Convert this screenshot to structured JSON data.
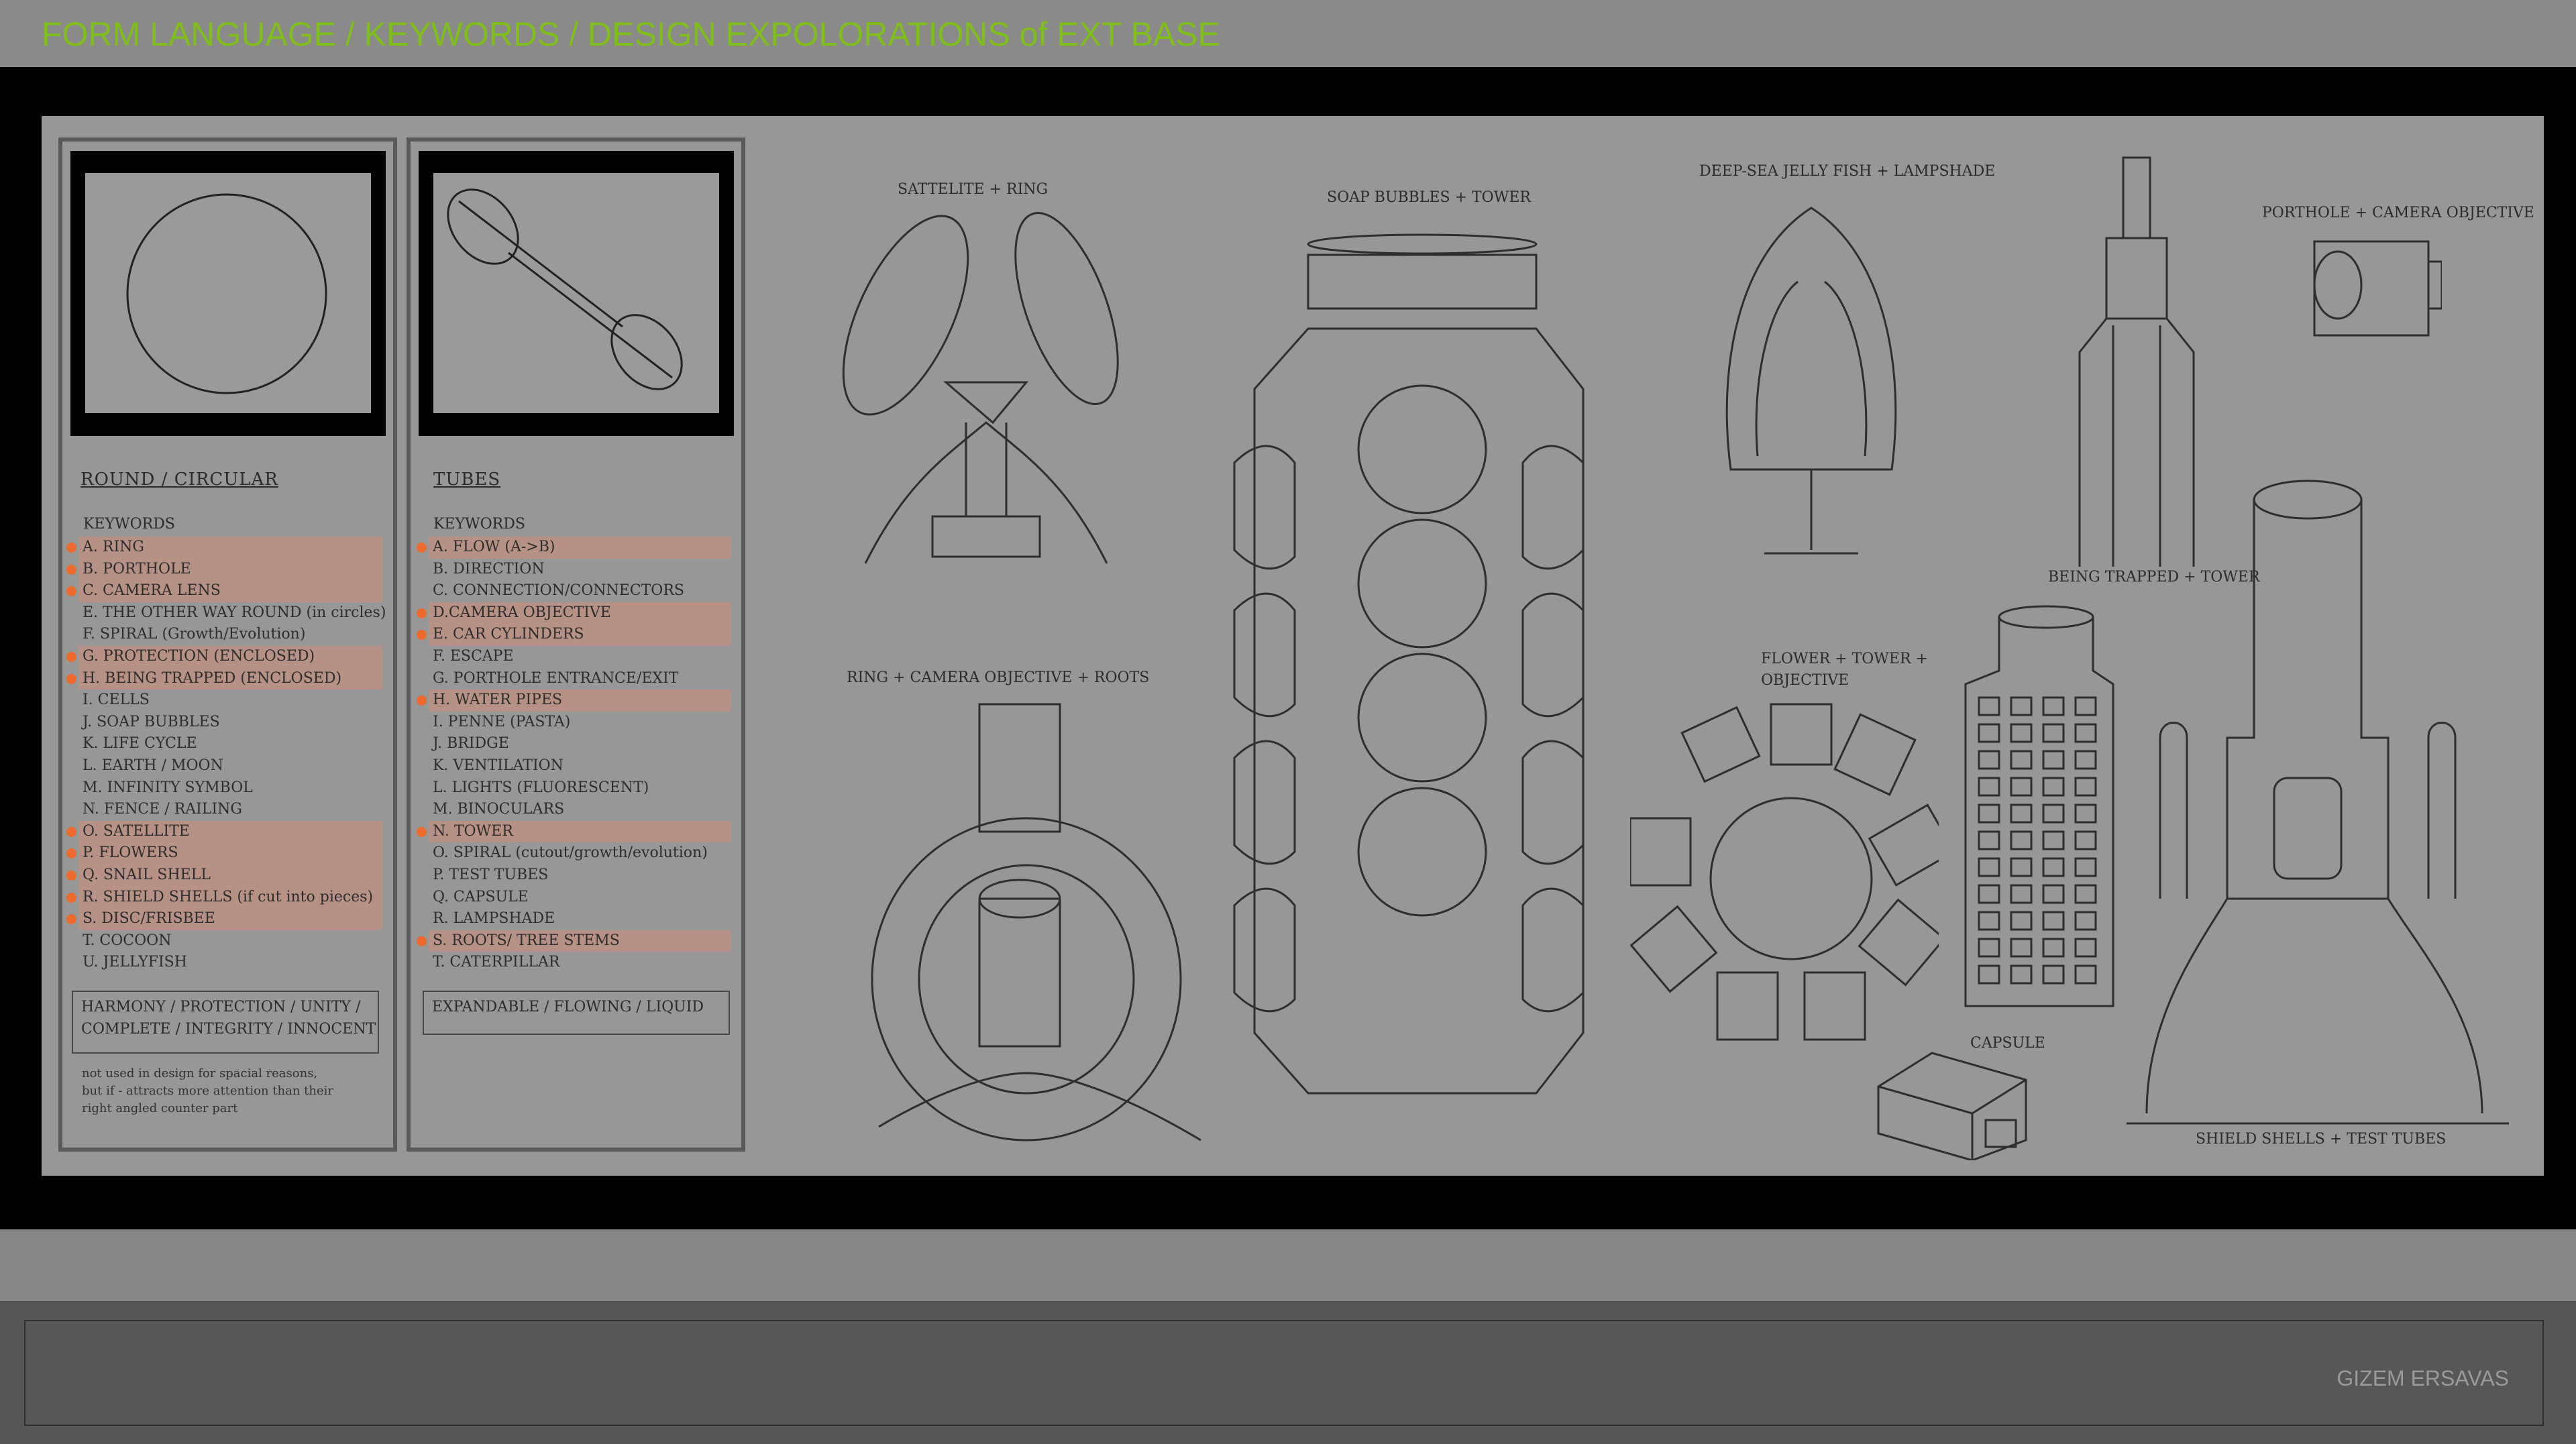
{
  "title": "FORM LANGUAGE / KEYWORDS / DESIGN EXPOLORATIONS of EXT BASE",
  "author": "GIZEM ERSAVAS",
  "colors": {
    "title": "#7fbf1a",
    "highlight_dot": "#ee6a2a",
    "highlight_bg": "#d28c78"
  },
  "round": {
    "heading": "ROUND / CIRCULAR",
    "keywords_title": "KEYWORDS",
    "items": [
      {
        "text": "A. RING",
        "hl": true
      },
      {
        "text": "B. PORTHOLE",
        "hl": true
      },
      {
        "text": "C. CAMERA LENS",
        "hl": true
      },
      {
        "text": "E. THE OTHER WAY ROUND (in circles)",
        "hl": false
      },
      {
        "text": "F. SPIRAL (Growth/Evolution)",
        "hl": false
      },
      {
        "text": "G. PROTECTION (ENCLOSED)",
        "hl": true
      },
      {
        "text": "H. BEING TRAPPED (ENCLOSED)",
        "hl": true
      },
      {
        "text": "I. CELLS",
        "hl": false
      },
      {
        "text": "J. SOAP BUBBLES",
        "hl": false
      },
      {
        "text": "K. LIFE CYCLE",
        "hl": false
      },
      {
        "text": "L. EARTH / MOON",
        "hl": false
      },
      {
        "text": "M. INFINITY SYMBOL",
        "hl": false
      },
      {
        "text": "N. FENCE / RAILING",
        "hl": false
      },
      {
        "text": "O. SATELLITE",
        "hl": true
      },
      {
        "text": "P. FLOWERS",
        "hl": true
      },
      {
        "text": "Q. SNAIL SHELL",
        "hl": true
      },
      {
        "text": "R. SHIELD SHELLS (if cut into pieces)",
        "hl": true
      },
      {
        "text": "S. DISC/FRISBEE",
        "hl": true
      },
      {
        "text": "T. COCOON",
        "hl": false
      },
      {
        "text": "U. JELLYFISH",
        "hl": false
      }
    ],
    "summary_line1": "HARMONY / PROTECTION / UNITY /",
    "summary_line2": "COMPLETE / INTEGRITY / INNOCENT",
    "note_line1": "not used in design for spacial reasons,",
    "note_line2": "but if - attracts more attention than their",
    "note_line3": "right angled counter part"
  },
  "tubes": {
    "heading": "TUBES",
    "keywords_title": "KEYWORDS",
    "items": [
      {
        "text": "A. FLOW (A->B)",
        "hl": true
      },
      {
        "text": "B. DIRECTION",
        "hl": false
      },
      {
        "text": "C. CONNECTION/CONNECTORS",
        "hl": false
      },
      {
        "text": "D.CAMERA OBJECTIVE",
        "hl": true
      },
      {
        "text": "E. CAR CYLINDERS",
        "hl": true
      },
      {
        "text": "F. ESCAPE",
        "hl": false
      },
      {
        "text": "G. PORTHOLE ENTRANCE/EXIT",
        "hl": false
      },
      {
        "text": "H. WATER PIPES",
        "hl": true
      },
      {
        "text": "I. PENNE (PASTA)",
        "hl": false
      },
      {
        "text": "J. BRIDGE",
        "hl": false
      },
      {
        "text": "K. VENTILATION",
        "hl": false
      },
      {
        "text": "L. LIGHTS (FLUORESCENT)",
        "hl": false
      },
      {
        "text": "M. BINOCULARS",
        "hl": false
      },
      {
        "text": "N. TOWER",
        "hl": true
      },
      {
        "text": "O. SPIRAL (cutout/growth/evolution)",
        "hl": false
      },
      {
        "text": "P. TEST TUBES",
        "hl": false
      },
      {
        "text": "Q. CAPSULE",
        "hl": false
      },
      {
        "text": "R. LAMPSHADE",
        "hl": false
      },
      {
        "text": "S. ROOTS/ TREE STEMS",
        "hl": true
      },
      {
        "text": "T. CATERPILLAR",
        "hl": false
      }
    ],
    "summary": "EXPANDABLE / FLOWING / LIQUID"
  },
  "sketch_labels": {
    "satellite": "SATTELITE + RING",
    "soap": "SOAP BUBBLES + TOWER",
    "jelly": "DEEP-SEA JELLY FISH + LAMPSHADE",
    "porthole": "PORTHOLE + CAMERA OBJECTIVE",
    "trapped": "BEING TRAPPED + TOWER",
    "ringcam": "RING + CAMERA OBJECTIVE + ROOTS",
    "flower_line1": "FLOWER + TOWER +",
    "flower_line2": "OBJECTIVE",
    "capsule": "CAPSULE",
    "shield": "SHIELD SHELLS + TEST TUBES"
  }
}
